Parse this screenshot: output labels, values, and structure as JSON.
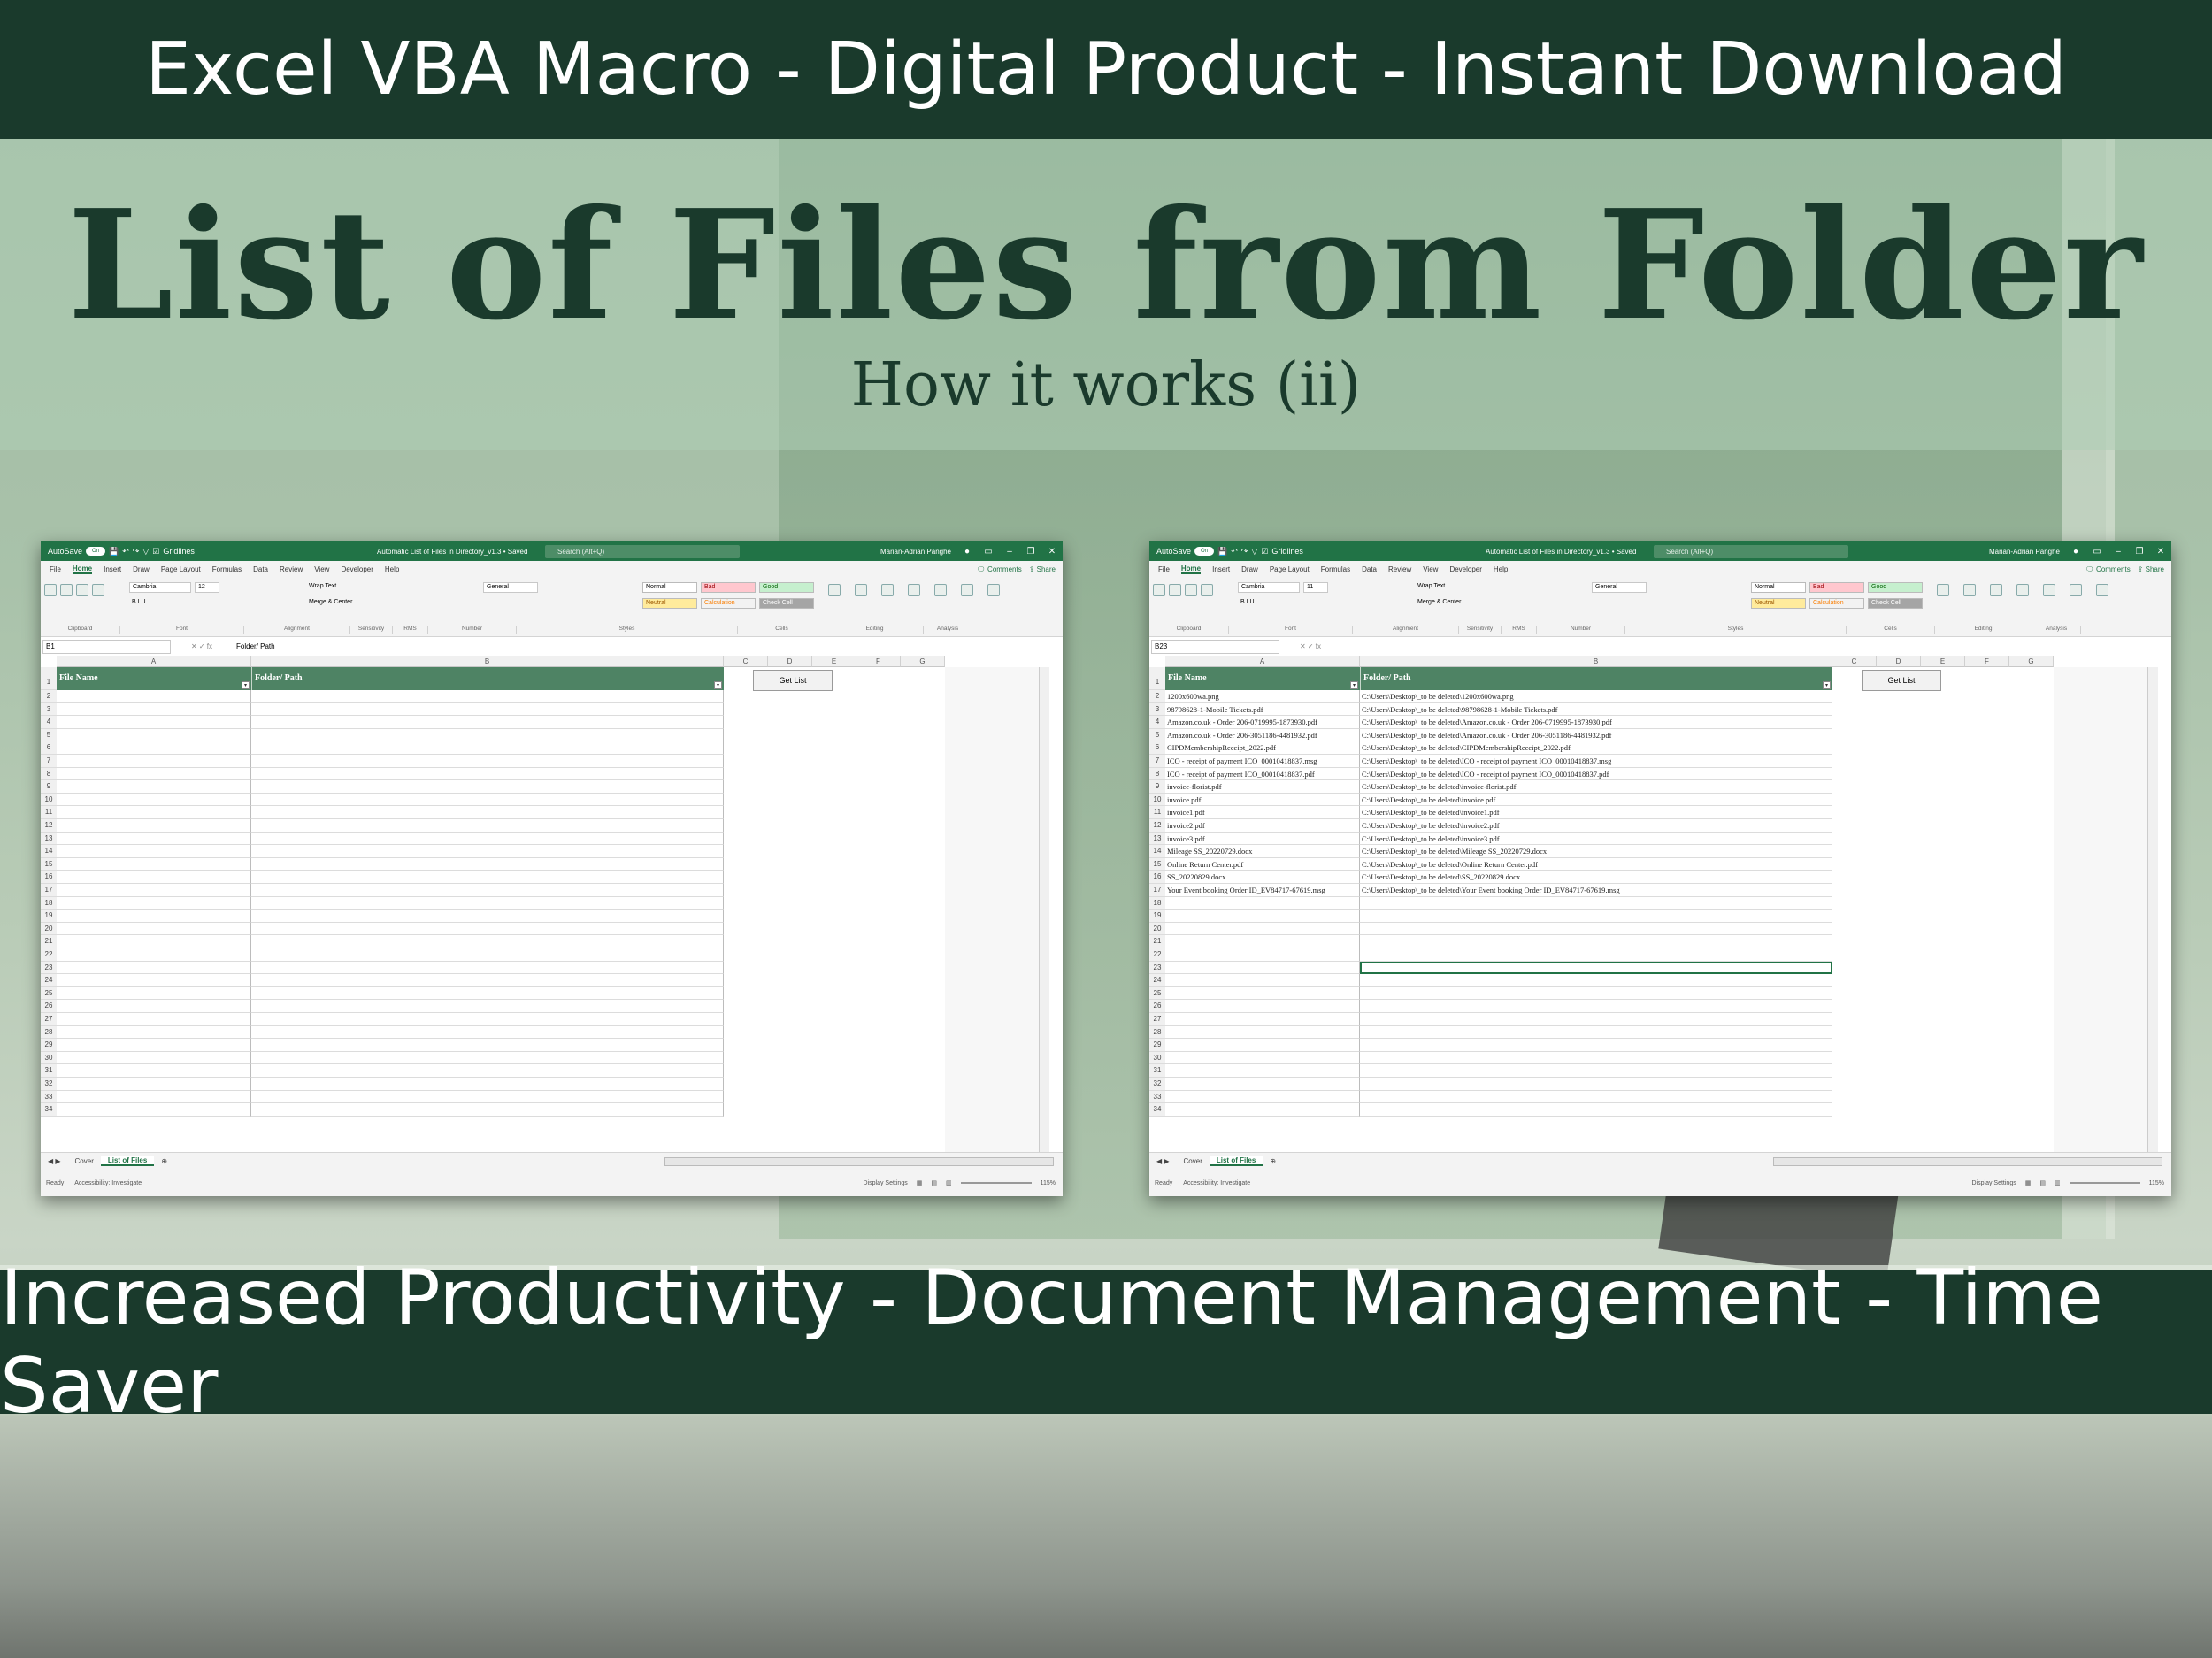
{
  "banner_top": "Excel VBA Macro - Digital Product - Instant Download",
  "title": "List of Files from Folder",
  "subtitle": "How it works (ii)",
  "banner_bottom": "Increased Productivity - Document Management - Time Saver",
  "excel": {
    "autosave": "AutoSave",
    "autosave_state": "On",
    "filename": "Automatic List of Files in Directory_v1.3 • Saved",
    "search_placeholder": "Search (Alt+Q)",
    "user": "Marian-Adrian Panghe",
    "menu": [
      "File",
      "Home",
      "Insert",
      "Draw",
      "Page Layout",
      "Formulas",
      "Data",
      "Review",
      "View",
      "Developer",
      "Help"
    ],
    "comments": "Comments",
    "share": "Share",
    "ribbon_groups": [
      "Clipboard",
      "Font",
      "Alignment",
      "Sensitivity",
      "RMS",
      "Number",
      "Styles",
      "Cells",
      "Editing",
      "Analysis"
    ],
    "font_name": "Cambria",
    "font_size_left": "12",
    "font_size_right": "11",
    "number_format": "General",
    "styles": [
      "Normal",
      "Bad",
      "Good",
      "Neutral",
      "Calculation",
      "Check Cell"
    ],
    "wrap_text": "Wrap Text",
    "merge_center": "Merge & Center",
    "columns": [
      "A",
      "B",
      "C",
      "D",
      "E",
      "F",
      "G"
    ],
    "header_file": "File Name",
    "header_path": "Folder/ Path",
    "button": "Get List",
    "tabs": [
      "Cover",
      "List of Files"
    ],
    "status_ready": "Ready",
    "accessibility": "Accessibility: Investigate",
    "display_settings": "Display Settings",
    "zoom": "115%"
  },
  "left": {
    "namebox": "B1",
    "formula": "Folder/ Path"
  },
  "right": {
    "namebox": "B23",
    "formula": "",
    "files": [
      {
        "name": "1200x600wa.png",
        "path": "C:\\Users\\Desktop\\_to be deleted\\1200x600wa.png"
      },
      {
        "name": "98798628-1-Mobile Tickets.pdf",
        "path": "C:\\Users\\Desktop\\_to be deleted\\98798628-1-Mobile Tickets.pdf"
      },
      {
        "name": "Amazon.co.uk - Order 206-0719995-1873930.pdf",
        "path": "C:\\Users\\Desktop\\_to be deleted\\Amazon.co.uk - Order 206-0719995-1873930.pdf"
      },
      {
        "name": "Amazon.co.uk - Order 206-3051186-4481932.pdf",
        "path": "C:\\Users\\Desktop\\_to be deleted\\Amazon.co.uk - Order 206-3051186-4481932.pdf"
      },
      {
        "name": "CIPDMembershipReceipt_2022.pdf",
        "path": "C:\\Users\\Desktop\\_to be deleted\\CIPDMembershipReceipt_2022.pdf"
      },
      {
        "name": "ICO - receipt of payment ICO_00010418837.msg",
        "path": "C:\\Users\\Desktop\\_to be deleted\\ICO - receipt of payment ICO_00010418837.msg"
      },
      {
        "name": "ICO - receipt of payment ICO_00010418837.pdf",
        "path": "C:\\Users\\Desktop\\_to be deleted\\ICO - receipt of payment ICO_00010418837.pdf"
      },
      {
        "name": "invoice-florist.pdf",
        "path": "C:\\Users\\Desktop\\_to be deleted\\invoice-florist.pdf"
      },
      {
        "name": "invoice.pdf",
        "path": "C:\\Users\\Desktop\\_to be deleted\\invoice.pdf"
      },
      {
        "name": "invoice1.pdf",
        "path": "C:\\Users\\Desktop\\_to be deleted\\invoice1.pdf"
      },
      {
        "name": "invoice2.pdf",
        "path": "C:\\Users\\Desktop\\_to be deleted\\invoice2.pdf"
      },
      {
        "name": "invoice3.pdf",
        "path": "C:\\Users\\Desktop\\_to be deleted\\invoice3.pdf"
      },
      {
        "name": "Mileage SS_20220729.docx",
        "path": "C:\\Users\\Desktop\\_to be deleted\\Mileage SS_20220729.docx"
      },
      {
        "name": "Online Return Center.pdf",
        "path": "C:\\Users\\Desktop\\_to be deleted\\Online Return Center.pdf"
      },
      {
        "name": "SS_20220829.docx",
        "path": "C:\\Users\\Desktop\\_to be deleted\\SS_20220829.docx"
      },
      {
        "name": "Your Event booking Order ID_EV84717-67619.msg",
        "path": "C:\\Users\\Desktop\\_to be deleted\\Your Event booking Order ID_EV84717-67619.msg"
      }
    ]
  },
  "row_count": 34
}
